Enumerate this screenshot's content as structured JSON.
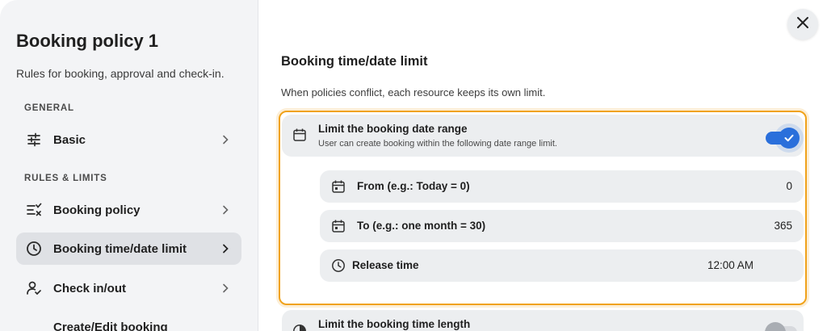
{
  "sidebar": {
    "title": "Booking policy 1",
    "subtitle": "Rules for booking, approval and check-in.",
    "sections": {
      "general": "GENERAL",
      "rules": "RULES & LIMITS"
    },
    "items": [
      {
        "label": "Basic",
        "icon": "sliders-icon"
      },
      {
        "label": "Booking policy",
        "icon": "checklist-icon"
      },
      {
        "label": "Booking time/date limit",
        "icon": "clock-icon",
        "active": true
      },
      {
        "label": "Check in/out",
        "icon": "user-check-icon"
      },
      {
        "label": "Create/Edit booking",
        "icon": ""
      }
    ]
  },
  "main": {
    "title": "Booking time/date limit",
    "description": "When policies conflict, each resource keeps its own limit.",
    "date_range": {
      "title": "Limit the booking date range",
      "subtitle": "User can create booking within the following date range limit.",
      "enabled": true,
      "from_label": "From (e.g.: Today = 0)",
      "from_value": "0",
      "to_label": "To (e.g.: one month = 30)",
      "to_value": "365",
      "release_label": "Release time",
      "release_value": "12:00 AM"
    },
    "time_length": {
      "title": "Limit the booking time length",
      "enabled": false
    }
  },
  "colors": {
    "accent": "#2a6fdb",
    "highlight": "#f0a21a",
    "sidebar_bg": "#f3f4f6",
    "card_bg": "#eceef0"
  }
}
